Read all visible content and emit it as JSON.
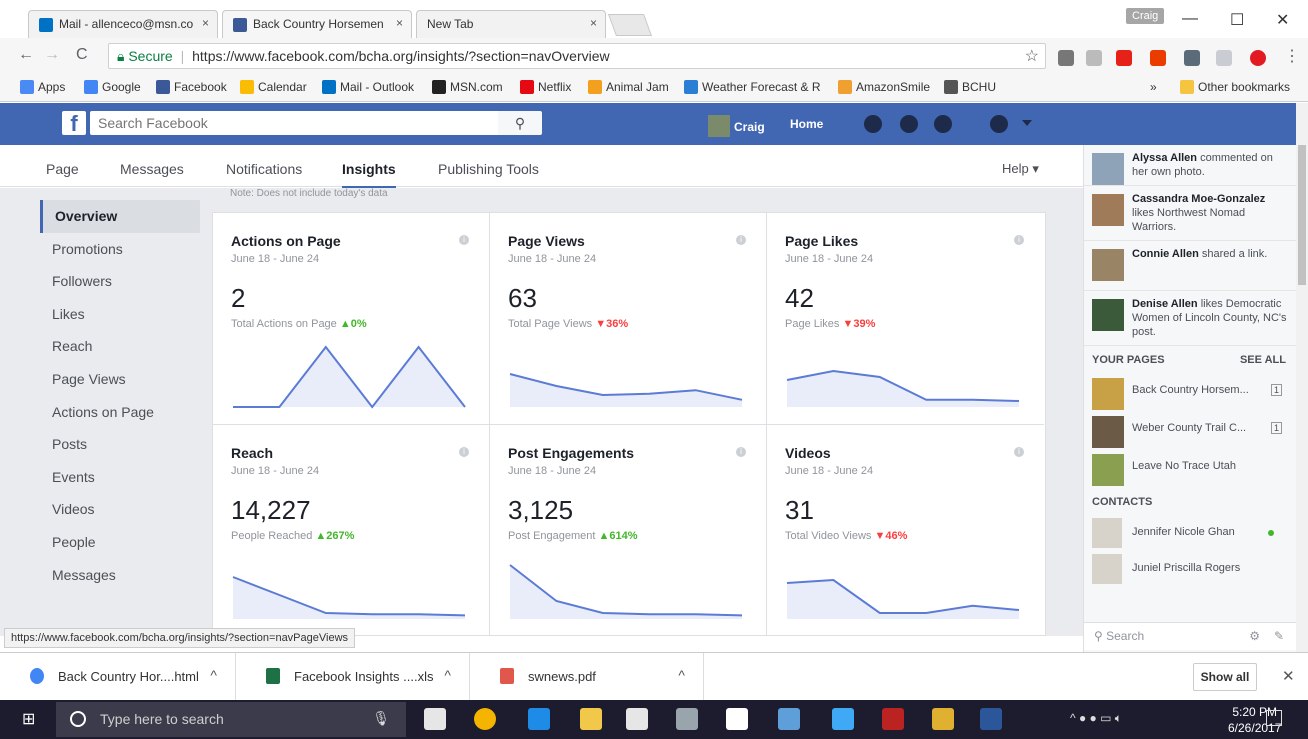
{
  "browser": {
    "tabs": [
      {
        "title": "Mail - allenceco@msn.co",
        "close": "×"
      },
      {
        "title": "Back Country Horsemen",
        "close": "×"
      },
      {
        "title": "New Tab",
        "close": "×"
      }
    ],
    "user_badge": "Craig",
    "window_controls": {
      "minimize": "—",
      "maximize": "☐",
      "close": "✕"
    },
    "nav": {
      "back": "←",
      "forward": "→",
      "reload": "C"
    },
    "secure_label": "Secure",
    "url": "https://www.facebook.com/bcha.org/insights/?section=navOverview",
    "bookmarks": [
      "Apps",
      "Google",
      "Facebook",
      "Calendar",
      "Mail - Outlook",
      "MSN.com",
      "Netflix",
      "Animal Jam",
      "Weather Forecast & R",
      "AmazonSmile",
      "BCHU"
    ],
    "bookmarks_overflow": "»",
    "other_bookmarks": "Other bookmarks"
  },
  "fb": {
    "search_placeholder": "Search Facebook",
    "user_name": "Craig",
    "home": "Home"
  },
  "page_nav": {
    "items": [
      "Page",
      "Messages",
      "Notifications",
      "Insights",
      "Publishing Tools"
    ],
    "active": "Insights",
    "help": "Help ▾"
  },
  "left_nav": {
    "items": [
      "Overview",
      "Promotions",
      "Followers",
      "Likes",
      "Reach",
      "Page Views",
      "Actions on Page",
      "Posts",
      "Events",
      "Videos",
      "People",
      "Messages"
    ],
    "active": "Overview"
  },
  "insights": {
    "note": "Note: Does not include today's data",
    "info_glyph": "i",
    "cards": [
      {
        "title": "Actions on Page",
        "range": "June 18 - June 24",
        "value": "2",
        "sub": "Total Actions on Page",
        "delta": "▲0%",
        "dir": "up",
        "spark": [
          0,
          0,
          1,
          0,
          1,
          0
        ]
      },
      {
        "title": "Page Views",
        "range": "June 18 - June 24",
        "value": "63",
        "sub": "Total Page Views",
        "delta": "▼36%",
        "dir": "down",
        "spark": [
          0.55,
          0.35,
          0.2,
          0.22,
          0.28,
          0.12
        ]
      },
      {
        "title": "Page Likes",
        "range": "June 18 - June 24",
        "value": "42",
        "sub": "Page Likes",
        "delta": "▼39%",
        "dir": "down",
        "spark": [
          0.45,
          0.6,
          0.5,
          0.12,
          0.12,
          0.1
        ]
      },
      {
        "title": "Reach",
        "range": "June 18 - June 24",
        "value": "14,227",
        "sub": "People Reached",
        "delta": "▲267%",
        "dir": "up",
        "spark": [
          0.7,
          0.4,
          0.1,
          0.08,
          0.08,
          0.06
        ]
      },
      {
        "title": "Post Engagements",
        "range": "June 18 - June 24",
        "value": "3,125",
        "sub": "Post Engagement",
        "delta": "▲614%",
        "dir": "up",
        "spark": [
          0.9,
          0.3,
          0.1,
          0.08,
          0.08,
          0.06
        ]
      },
      {
        "title": "Videos",
        "range": "June 18 - June 24",
        "value": "31",
        "sub": "Total Video Views",
        "delta": "▼46%",
        "dir": "down",
        "spark": [
          0.6,
          0.65,
          0.1,
          0.1,
          0.22,
          0.15
        ]
      }
    ]
  },
  "ticker": [
    {
      "name": "Alyssa Allen",
      "text": "commented on her own photo."
    },
    {
      "name": "Cassandra Moe-Gonzalez",
      "text": "likes Northwest Nomad Warriors."
    },
    {
      "name": "Connie Allen",
      "text": "shared a link."
    },
    {
      "name": "Denise Allen",
      "text": "likes Democratic Women of Lincoln County, NC's post."
    }
  ],
  "your_pages": {
    "heading": "YOUR PAGES",
    "see_all": "SEE ALL",
    "items": [
      {
        "name": "Back Country Horsem...",
        "count": "1"
      },
      {
        "name": "Weber County Trail C...",
        "count": "1"
      },
      {
        "name": "Leave No Trace Utah",
        "count": ""
      }
    ]
  },
  "contacts": {
    "heading": "CONTACTS",
    "items": [
      "Jennifer Nicole Ghan",
      "Juniel Priscilla Rogers"
    ],
    "search_placeholder": "Search"
  },
  "status_url": "https://www.facebook.com/bcha.org/insights/?section=navPageViews",
  "downloads": {
    "items": [
      "Back Country Hor....html",
      "Facebook Insights ....xls",
      "swnews.pdf"
    ],
    "caret": "^",
    "show_all": "Show all",
    "close": "✕"
  },
  "taskbar": {
    "search_placeholder": "Type here to search",
    "time": "5:20 PM",
    "date": "6/26/2017"
  },
  "colors": {
    "fb_blue": "#4267b2",
    "up": "#42b72a",
    "down": "#fa3e3e",
    "spark_line": "#5b7bd5",
    "spark_fill": "#e9edf9"
  }
}
